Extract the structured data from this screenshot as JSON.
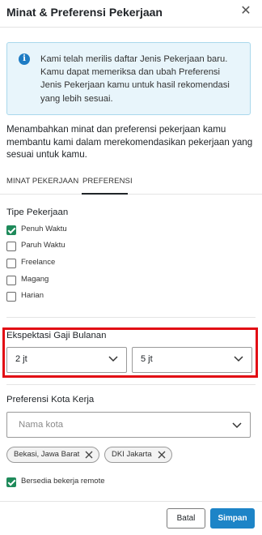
{
  "modal": {
    "title": "Minat & Preferensi Pekerjaan",
    "close_icon": "close-icon"
  },
  "info": {
    "icon": "info-icon",
    "text": "Kami telah merilis daftar Jenis Pekerjaan baru. Kamu dapat memeriksa dan ubah Preferensi Jenis Pekerjaan kamu untuk hasil rekomendasi yang lebih sesuai."
  },
  "intro": "Menambahkan minat dan preferensi pekerjaan kamu membantu kami dalam merekomendasikan pekerjaan yang sesuai untuk kamu.",
  "tabs": [
    {
      "label": "MINAT PEKERJAAN",
      "active": false
    },
    {
      "label": "PREFERENSI",
      "active": true
    }
  ],
  "job_type": {
    "label": "Tipe Pekerjaan",
    "options": [
      {
        "label": "Penuh Waktu",
        "checked": true
      },
      {
        "label": "Paruh Waktu",
        "checked": false
      },
      {
        "label": "Freelance",
        "checked": false
      },
      {
        "label": "Magang",
        "checked": false
      },
      {
        "label": "Harian",
        "checked": false
      }
    ]
  },
  "salary": {
    "label": "Ekspektasi Gaji Bulanan",
    "min": "2 jt",
    "max": "5 jt",
    "highlight_color": "#e20c14"
  },
  "city": {
    "label": "Preferensi Kota Kerja",
    "placeholder": "Nama kota",
    "chips": [
      "Bekasi, Jawa Barat",
      "DKI Jakarta"
    ]
  },
  "remote": {
    "label": "Bersedia bekerja remote",
    "checked": true
  },
  "footer": {
    "cancel_label": "Batal",
    "save_label": "Simpan",
    "primary_color": "#1d84c7"
  }
}
